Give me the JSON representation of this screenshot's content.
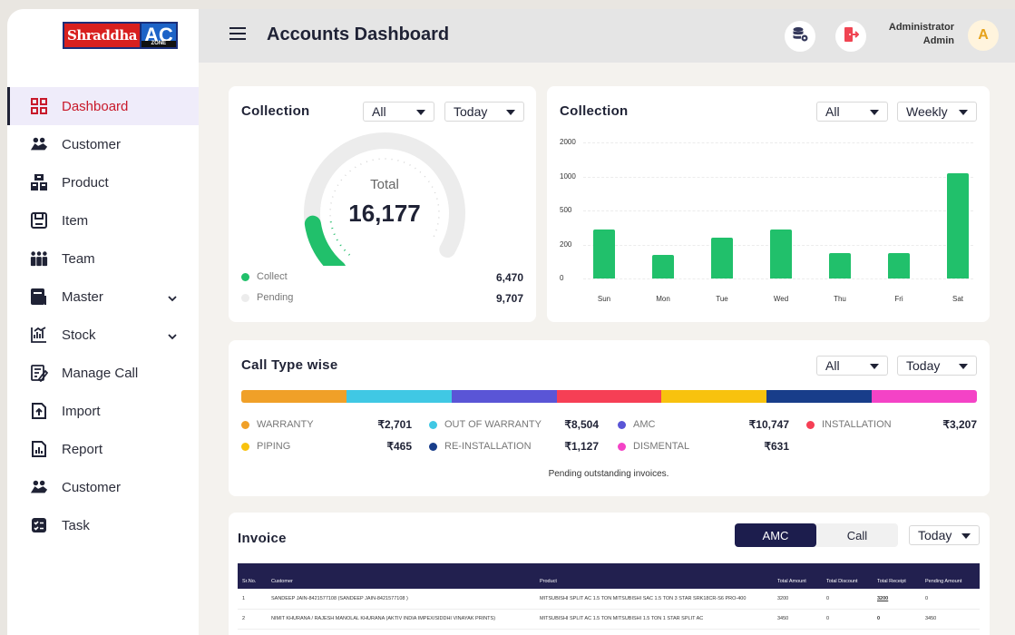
{
  "app": {
    "logo_text": "Shraddha",
    "logo_ac": "AC",
    "logo_zone": "ZONE",
    "page_title": "Accounts Dashboard"
  },
  "sidebar": {
    "items": [
      {
        "label": "Dashboard",
        "icon": "dashboard-icon",
        "active": true
      },
      {
        "label": "Customer",
        "icon": "customer-icon"
      },
      {
        "label": "Product",
        "icon": "product-icon"
      },
      {
        "label": "Item",
        "icon": "item-icon"
      },
      {
        "label": "Team",
        "icon": "team-icon"
      },
      {
        "label": "Master",
        "icon": "master-icon",
        "expandable": true
      },
      {
        "label": "Stock",
        "icon": "stock-icon",
        "expandable": true
      },
      {
        "label": "Manage Call",
        "icon": "manage-call-icon"
      },
      {
        "label": "Import",
        "icon": "import-icon"
      },
      {
        "label": "Report",
        "icon": "report-icon"
      },
      {
        "label": "Customer",
        "icon": "customer-icon"
      },
      {
        "label": "Task",
        "icon": "task-icon"
      }
    ]
  },
  "header": {
    "user_role": "Administrator",
    "user_name": "Admin",
    "avatar_letter": "A"
  },
  "collection_total": {
    "title": "Collection",
    "filter_type": "All",
    "filter_period": "Today",
    "center_label": "Total",
    "center_value": "16,177",
    "collect_label": "Collect",
    "collect_value": "6,470",
    "pending_label": "Pending",
    "pending_value": "9,707",
    "collect_color": "#21c06b",
    "pending_color": "#ececec",
    "collect_fraction": 0.4
  },
  "chart_data": {
    "type": "bar",
    "title": "Collection",
    "filter_type": "All",
    "filter_period": "Weekly",
    "categories": [
      "Sun",
      "Mon",
      "Tue",
      "Wed",
      "Thu",
      "Fri",
      "Sat"
    ],
    "values": [
      330,
      140,
      260,
      330,
      150,
      150,
      1100
    ],
    "y_ticks": [
      "2000",
      "1000",
      "500",
      "200",
      "0"
    ],
    "color": "#21c06b"
  },
  "call_type": {
    "title": "Call Type wise",
    "filter_type": "All",
    "filter_period": "Today",
    "segments": [
      {
        "label": "WARRANTY",
        "value": "₹2,701",
        "color": "#f0a028"
      },
      {
        "label": "OUT OF WARRANTY",
        "value": "₹8,504",
        "color": "#40c8e4"
      },
      {
        "label": "AMC",
        "value": "₹10,747",
        "color": "#5a55d6"
      },
      {
        "label": "INSTALLATION",
        "value": "₹3,207",
        "color": "#f63f55"
      },
      {
        "label": "PIPING",
        "value": "₹465",
        "color": "#f8c20e"
      },
      {
        "label": "RE-INSTALLATION",
        "value": "₹1,127",
        "color": "#183d8a"
      },
      {
        "label": "DISMENTAL",
        "value": "₹631",
        "color": "#f443c6"
      }
    ],
    "note": "Pending outstanding invoices."
  },
  "invoice": {
    "title": "Invoice",
    "toggle_amc": "AMC",
    "toggle_call": "Call",
    "filter_period": "Today",
    "columns": [
      "Sr.No.",
      "Customer",
      "Product",
      "Total Amount",
      "Total Discount",
      "Total Receipt",
      "Pending Amount"
    ],
    "rows": [
      [
        "1",
        "SANDEEP JAIN-8421577108 (SANDEEP JAIN-8421577108 )",
        "MITSUBISHI SPLIT AC 1.5 TON MITSUBISHI SAC 1.5 TON 3 STAR SRK18CR-S6 PRO-400",
        "3200",
        "0",
        "3200",
        "0"
      ],
      [
        "2",
        "NIMIT KHURANA / RAJESH MANOLAL KHURANA (AKTIV INDIA IMPEX/SIDDHI VINAYAK PRINTS)",
        "MITSUBISHI SPLIT AC 1.5 TON MITSUBISHI 1.5 TON 1 STAR SPLIT AC",
        "3450",
        "0",
        "0",
        "3450"
      ]
    ]
  }
}
